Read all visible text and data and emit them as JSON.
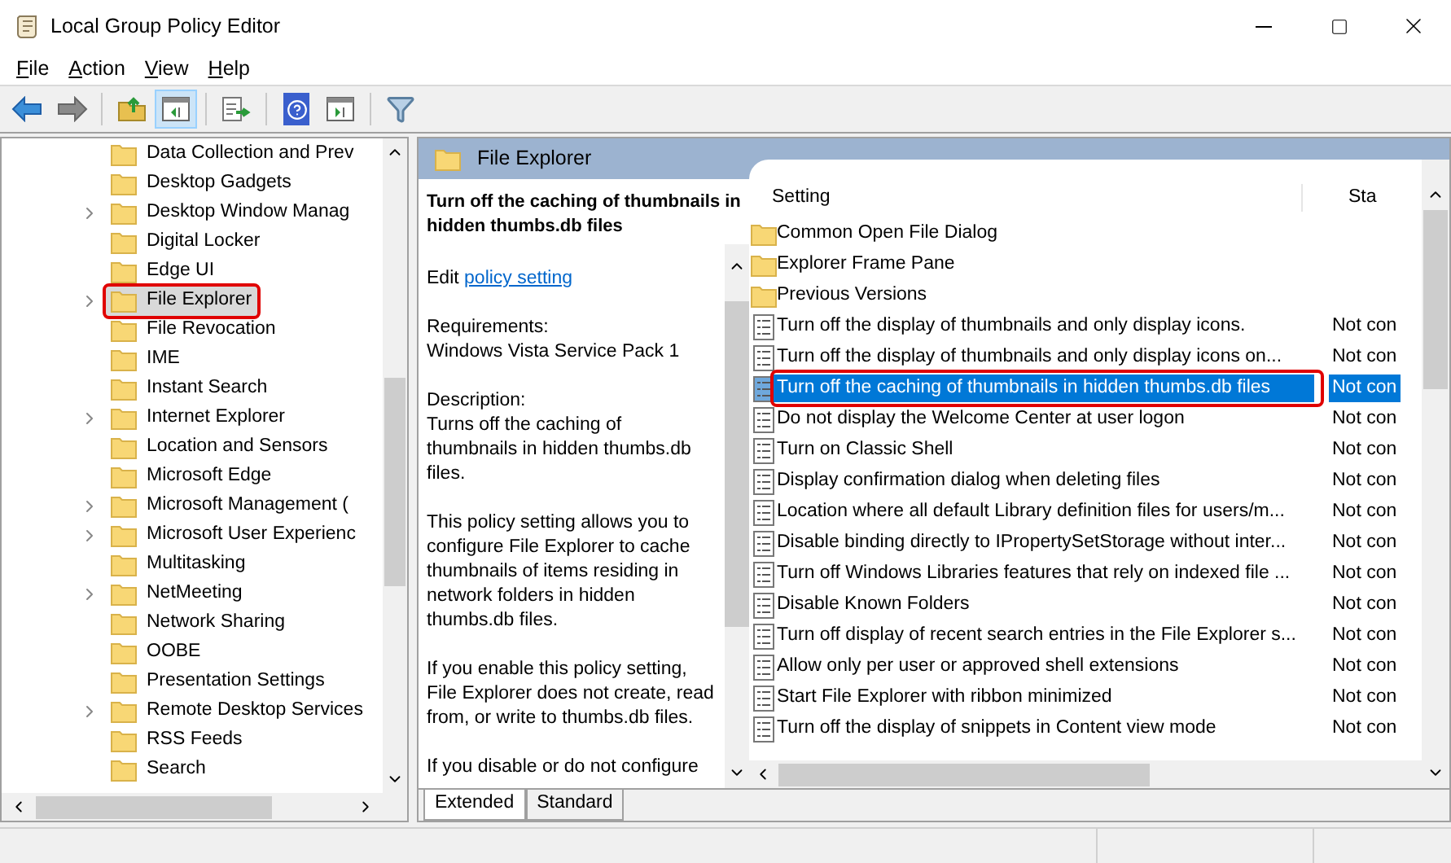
{
  "window": {
    "title": "Local Group Policy Editor"
  },
  "menu": [
    {
      "label": "File"
    },
    {
      "label": "Action"
    },
    {
      "label": "View"
    },
    {
      "label": "Help"
    }
  ],
  "toolbar": [
    [
      {
        "kind": "back",
        "pressed": false
      },
      {
        "kind": "forward",
        "pressed": false
      }
    ],
    [
      {
        "kind": "up",
        "pressed": false
      },
      {
        "kind": "tree",
        "pressed": true
      }
    ],
    [
      {
        "kind": "export",
        "pressed": false
      }
    ],
    [
      {
        "kind": "help",
        "pressed": false
      },
      {
        "kind": "pane",
        "pressed": false
      }
    ],
    [
      {
        "kind": "filter",
        "pressed": false
      }
    ]
  ],
  "tree": {
    "items": [
      {
        "label": "Data Collection and Prev",
        "expandable": false,
        "selected": false,
        "marked": false
      },
      {
        "label": "Desktop Gadgets",
        "expandable": false,
        "selected": false,
        "marked": false
      },
      {
        "label": "Desktop Window Manag",
        "expandable": true,
        "selected": false,
        "marked": false
      },
      {
        "label": "Digital Locker",
        "expandable": false,
        "selected": false,
        "marked": false
      },
      {
        "label": "Edge UI",
        "expandable": false,
        "selected": false,
        "marked": false
      },
      {
        "label": "File Explorer",
        "expandable": true,
        "selected": true,
        "marked": true
      },
      {
        "label": "File Revocation",
        "expandable": false,
        "selected": false,
        "marked": false
      },
      {
        "label": "IME",
        "expandable": false,
        "selected": false,
        "marked": false
      },
      {
        "label": "Instant Search",
        "expandable": false,
        "selected": false,
        "marked": false
      },
      {
        "label": "Internet Explorer",
        "expandable": true,
        "selected": false,
        "marked": false
      },
      {
        "label": "Location and Sensors",
        "expandable": false,
        "selected": false,
        "marked": false
      },
      {
        "label": "Microsoft Edge",
        "expandable": false,
        "selected": false,
        "marked": false
      },
      {
        "label": "Microsoft Management (",
        "expandable": true,
        "selected": false,
        "marked": false
      },
      {
        "label": "Microsoft User Experienc",
        "expandable": true,
        "selected": false,
        "marked": false
      },
      {
        "label": "Multitasking",
        "expandable": false,
        "selected": false,
        "marked": false
      },
      {
        "label": "NetMeeting",
        "expandable": true,
        "selected": false,
        "marked": false
      },
      {
        "label": "Network Sharing",
        "expandable": false,
        "selected": false,
        "marked": false
      },
      {
        "label": "OOBE",
        "expandable": false,
        "selected": false,
        "marked": false
      },
      {
        "label": "Presentation Settings",
        "expandable": false,
        "selected": false,
        "marked": false
      },
      {
        "label": "Remote Desktop Services",
        "expandable": true,
        "selected": false,
        "marked": false
      },
      {
        "label": "RSS Feeds",
        "expandable": false,
        "selected": false,
        "marked": false
      },
      {
        "label": "Search",
        "expandable": false,
        "selected": false,
        "marked": false
      }
    ]
  },
  "detail": {
    "header": "File Explorer",
    "title": "Turn off the caching of thumbnails in hidden thumbs.db files",
    "edit_prefix": "Edit",
    "edit_link": "policy setting",
    "paragraphs": [
      [
        "Requirements:",
        "Windows Vista Service Pack 1"
      ],
      [
        "Description:",
        "Turns off the caching of thumbnails in hidden thumbs.db files."
      ],
      [
        "This policy setting allows you to configure File Explorer to cache thumbnails of items residing in network folders in hidden thumbs.db files."
      ],
      [
        "If you enable this policy setting, File Explorer does not create, read from, or write to thumbs.db files."
      ],
      [
        "If you disable or do not configure"
      ]
    ]
  },
  "tabs": [
    {
      "label": "Extended",
      "selected": true
    },
    {
      "label": "Standard",
      "selected": false
    }
  ],
  "settings": {
    "columns": [
      "Setting",
      "Sta"
    ],
    "rows": [
      {
        "kind": "folder",
        "name": "Common Open File Dialog",
        "selected": false,
        "marked": false
      },
      {
        "kind": "folder",
        "name": "Explorer Frame Pane",
        "selected": false,
        "marked": false
      },
      {
        "kind": "folder",
        "name": "Previous Versions",
        "selected": false,
        "marked": false
      },
      {
        "kind": "policy",
        "name": "Turn off the display of thumbnails and only display icons.",
        "state": "Not con",
        "selected": false,
        "marked": false
      },
      {
        "kind": "policy",
        "name": "Turn off the display of thumbnails and only display icons on...",
        "state": "Not con",
        "selected": false,
        "marked": false
      },
      {
        "kind": "policy",
        "name": "Turn off the caching of thumbnails in hidden thumbs.db files",
        "state": "Not con",
        "selected": true,
        "marked": true
      },
      {
        "kind": "policy",
        "name": "Do not display the Welcome Center at user logon",
        "state": "Not con",
        "selected": false,
        "marked": false
      },
      {
        "kind": "policy",
        "name": "Turn on Classic Shell",
        "state": "Not con",
        "selected": false,
        "marked": false
      },
      {
        "kind": "policy",
        "name": "Display confirmation dialog when deleting files",
        "state": "Not con",
        "selected": false,
        "marked": false
      },
      {
        "kind": "policy",
        "name": "Location where all default Library definition files for users/m...",
        "state": "Not con",
        "selected": false,
        "marked": false
      },
      {
        "kind": "policy",
        "name": "Disable binding directly to IPropertySetStorage without inter...",
        "state": "Not con",
        "selected": false,
        "marked": false
      },
      {
        "kind": "policy",
        "name": "Turn off Windows Libraries features that rely on indexed file ...",
        "state": "Not con",
        "selected": false,
        "marked": false
      },
      {
        "kind": "policy",
        "name": "Disable Known Folders",
        "state": "Not con",
        "selected": false,
        "marked": false
      },
      {
        "kind": "policy",
        "name": "Turn off display of recent search entries in the File Explorer s...",
        "state": "Not con",
        "selected": false,
        "marked": false
      },
      {
        "kind": "policy",
        "name": "Allow only per user or approved shell extensions",
        "state": "Not con",
        "selected": false,
        "marked": false
      },
      {
        "kind": "policy",
        "name": "Start File Explorer with ribbon minimized",
        "state": "Not con",
        "selected": false,
        "marked": false
      },
      {
        "kind": "policy",
        "name": "Turn off the display of snippets in Content view mode",
        "state": "Not con",
        "selected": false,
        "marked": false
      }
    ]
  }
}
